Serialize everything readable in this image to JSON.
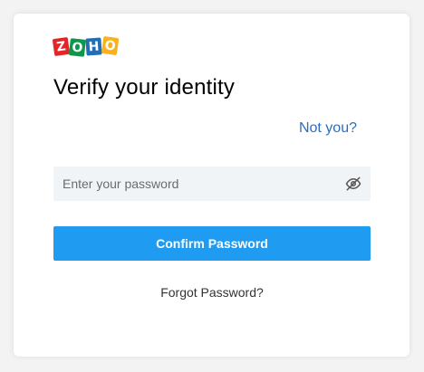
{
  "brand": {
    "logo_letters": [
      "Z",
      "O",
      "H",
      "O"
    ],
    "logo_colors": [
      "#e42527",
      "#089949",
      "#226db4",
      "#f9b21d"
    ]
  },
  "title": "Verify your identity",
  "not_you_label": "Not you?",
  "password": {
    "placeholder": "Enter your password",
    "value": "",
    "toggle_icon": "eye-off-icon"
  },
  "confirm_label": "Confirm Password",
  "forgot_label": "Forgot Password?",
  "colors": {
    "primary": "#1f9cf2",
    "link": "#2e6cbf",
    "input_bg": "#f1f4f7"
  }
}
